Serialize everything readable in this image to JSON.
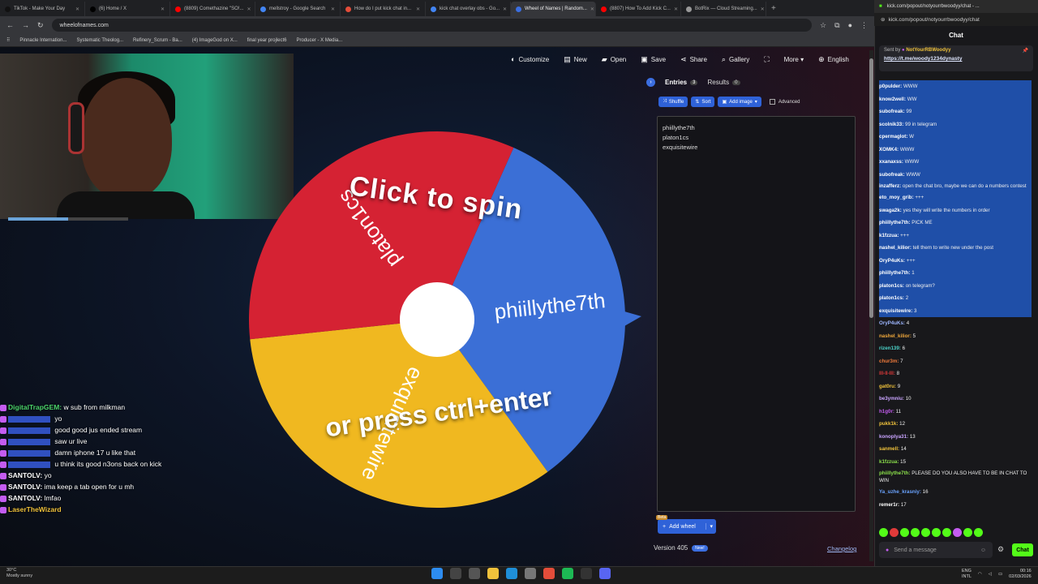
{
  "browser": {
    "tabs": [
      {
        "title": "TikTok - Make Your Day",
        "color": "#111111"
      },
      {
        "title": "(6) Home / X",
        "color": "#000000"
      },
      {
        "title": "(8809) Comethazine \"SO!...",
        "color": "#ff0000"
      },
      {
        "title": "mellstroy - Google Search",
        "color": "#4285f4"
      },
      {
        "title": "How do I put kick chat in...",
        "color": "#e44d3a"
      },
      {
        "title": "kick chat overlay obs - Go...",
        "color": "#4285f4"
      },
      {
        "title": "Wheel of Names | Random...",
        "color": "#3b6ee0",
        "active": true
      },
      {
        "title": "(8807) How To Add Kick C...",
        "color": "#ff0000"
      },
      {
        "title": "BotRix — Cloud Streaming...",
        "color": "#999999"
      }
    ],
    "url": "wheelofnames.com",
    "bookmarks": [
      "Pinnacle Internation...",
      "Systematic Theolog...",
      "Refinery_Scrum - Ba...",
      "(4) ImageGod on X...",
      "final year projlect6",
      "Producer - X Media..."
    ]
  },
  "toolbar": {
    "items": [
      {
        "label": "Customize",
        "icon": "palette-icon",
        "glyph": "◐"
      },
      {
        "label": "New",
        "icon": "new-file-icon",
        "glyph": "▤"
      },
      {
        "label": "Open",
        "icon": "folder-icon",
        "glyph": "▰"
      },
      {
        "label": "Save",
        "icon": "save-icon",
        "glyph": "▣"
      },
      {
        "label": "Share",
        "icon": "share-icon",
        "glyph": "⋖"
      },
      {
        "label": "Gallery",
        "icon": "search-icon",
        "glyph": "⌕"
      },
      {
        "label": "",
        "icon": "fullscreen-icon",
        "glyph": "⛶"
      },
      {
        "label": "More ▾",
        "icon": "more-icon",
        "glyph": ""
      },
      {
        "label": "English",
        "icon": "globe-icon",
        "glyph": "⊕"
      }
    ]
  },
  "wheel": {
    "hint_top": "Click to spin",
    "hint_bottom": "or press ctrl+enter",
    "segments": [
      {
        "label": "phiillythe7th",
        "color": "#3b6fd6"
      },
      {
        "label": "exquisitewire",
        "color": "#f0b820"
      },
      {
        "label": "platon1cs",
        "color": "#d52233"
      }
    ]
  },
  "panel": {
    "tab_entries": "Entries",
    "entries_count": "3",
    "tab_results": "Results",
    "results_count": "0",
    "shuffle": "Shuffle",
    "sort": "Sort",
    "add_image": "Add image",
    "advanced": "Advanced",
    "entries": [
      "phiillythe7th",
      "platon1cs",
      "exquisitewire"
    ],
    "add_wheel": "Add wheel",
    "beta": "Beta",
    "version": "Version 405",
    "new_badge": "New!",
    "changelog": "Changelog"
  },
  "overlay_chat": [
    {
      "name": "DigitalTrapGEM:",
      "text": "w sub from milkman",
      "color": "#4bd36a"
    },
    {
      "name": "",
      "text": "yo",
      "color": "#3050c0"
    },
    {
      "name": "",
      "text": "good good jus ended stream",
      "color": "#3050c0"
    },
    {
      "name": "",
      "text": "saw ur live",
      "color": "#3050c0"
    },
    {
      "name": "",
      "text": "damn iphone 17 u like that",
      "color": "#3050c0"
    },
    {
      "name": "",
      "text": "u think its good n3ons back on kick",
      "color": "#3050c0"
    },
    {
      "name": "SANTOLV:",
      "text": "yo",
      "color": "#ffffff"
    },
    {
      "name": "SANTOLV:",
      "text": "ima keep a tab open for u mh",
      "color": "#ffffff"
    },
    {
      "name": "SANTOLV:",
      "text": "lmfao",
      "color": "#ffffff"
    },
    {
      "name": "LaserTheWizard",
      "text": "",
      "color": "#f0c23b"
    }
  ],
  "kick": {
    "window_title": "kick.com/popout/notyourrbwoodyy/chat - ...",
    "url": "kick.com/popout/notyourrbwoodyy/chat",
    "header": "Chat",
    "pinned_by": "Sent by",
    "pinned_user": "NotYourRBWoodyy",
    "pinned_link": "https://t.me/woody1234dynasty",
    "messages": [
      {
        "user": "p0pulder:",
        "text": "WWW",
        "color": "#ffffff",
        "sel": true
      },
      {
        "user": "know2well:",
        "text": "WW",
        "color": "#ffffff",
        "sel": true
      },
      {
        "user": "subofreak:",
        "text": "99",
        "color": "#ffffff",
        "sel": true
      },
      {
        "user": "scolnik33:",
        "text": "99 in telegram",
        "color": "#ffffff",
        "sel": true
      },
      {
        "user": "cpermaglot:",
        "text": "W",
        "color": "#ffffff",
        "sel": true
      },
      {
        "user": "XOMK4:",
        "text": "WWW",
        "color": "#ffffff",
        "sel": true
      },
      {
        "user": "xxanaxss:",
        "text": "WWW",
        "color": "#ffffff",
        "sel": true
      },
      {
        "user": "subofreak:",
        "text": "WWW",
        "color": "#ffffff",
        "sel": true
      },
      {
        "user": "inzafferz:",
        "text": "open the chat bro, maybe we can do a numbers contest",
        "color": "#ffffff",
        "sel": true,
        "wrap": true
      },
      {
        "user": "eto_moy_grib:",
        "text": "+++",
        "color": "#ffffff",
        "sel": true
      },
      {
        "user": "swaga2k:",
        "text": "yes they will write the numbers in order",
        "color": "#ffffff",
        "sel": true
      },
      {
        "user": "phiillythe7th:",
        "text": "PICK ME",
        "color": "#ffffff",
        "sel": true
      },
      {
        "user": "k1fzzua:",
        "text": "+++",
        "color": "#ffffff",
        "sel": true
      },
      {
        "user": "nashel_kilior:",
        "text": "tell them to write new under the post",
        "color": "#ffffff",
        "sel": true
      },
      {
        "user": "OryP4uKs:",
        "text": "+++",
        "color": "#ffffff",
        "sel": true
      },
      {
        "user": "phiillythe7th:",
        "text": "1",
        "color": "#ffffff",
        "sel": true
      },
      {
        "user": "platon1cs:",
        "text": "on telegram?",
        "color": "#ffffff",
        "sel": true
      },
      {
        "user": "platon1cs:",
        "text": "2",
        "color": "#ffffff",
        "sel": true
      },
      {
        "user": "exquisitewire:",
        "text": "3",
        "color": "#ffffff",
        "sel": true
      },
      {
        "user": "OryP4uKs:",
        "text": "4",
        "color": "#9db6ff",
        "sel": false
      },
      {
        "user": "nashel_kilior:",
        "text": "5",
        "color": "#f0a83b",
        "sel": false
      },
      {
        "user": "rizen139:",
        "text": "6",
        "color": "#4bd3c9",
        "sel": false
      },
      {
        "user": "chur3m:",
        "text": "7",
        "color": "#f07a3b",
        "sel": false
      },
      {
        "user": "lll-ll-lll:",
        "text": "8",
        "color": "#e03a3a",
        "sel": false
      },
      {
        "user": "gat0ru:",
        "text": "9",
        "color": "#f0c23b",
        "sel": false
      },
      {
        "user": "be3ymniu:",
        "text": "10",
        "color": "#c9a4ff",
        "sel": false
      },
      {
        "user": "h1g0r:",
        "text": "11",
        "color": "#c45cf0",
        "sel": false
      },
      {
        "user": "pukk1k:",
        "text": "12",
        "color": "#f0c23b",
        "sel": false
      },
      {
        "user": "konoplya31:",
        "text": "13",
        "color": "#c9a4ff",
        "sel": false
      },
      {
        "user": "sanmell:",
        "text": "14",
        "color": "#f0c23b",
        "sel": false
      },
      {
        "user": "k1fzzua:",
        "text": "15",
        "color": "#8be04b",
        "sel": false
      },
      {
        "user": "phiillythe7th:",
        "text": "PLEASE DO YOU ALSO HAVE TO BE IN CHAT TO WIN",
        "color": "#8be04b",
        "sel": false,
        "wrap": true
      },
      {
        "user": "Ya_uzhe_krasniy:",
        "text": "16",
        "color": "#6aa3ff",
        "sel": false
      },
      {
        "user": "remer1r:",
        "text": "17",
        "color": "#ffffff",
        "sel": false
      }
    ],
    "send_placeholder": "Send a message",
    "chat_button": "Chat"
  },
  "taskbar": {
    "temp": "30°C",
    "weather": "Mostly sunny",
    "lang1": "ENG",
    "lang2": "INTL",
    "time": "00:16",
    "date": "02/03/2026"
  }
}
